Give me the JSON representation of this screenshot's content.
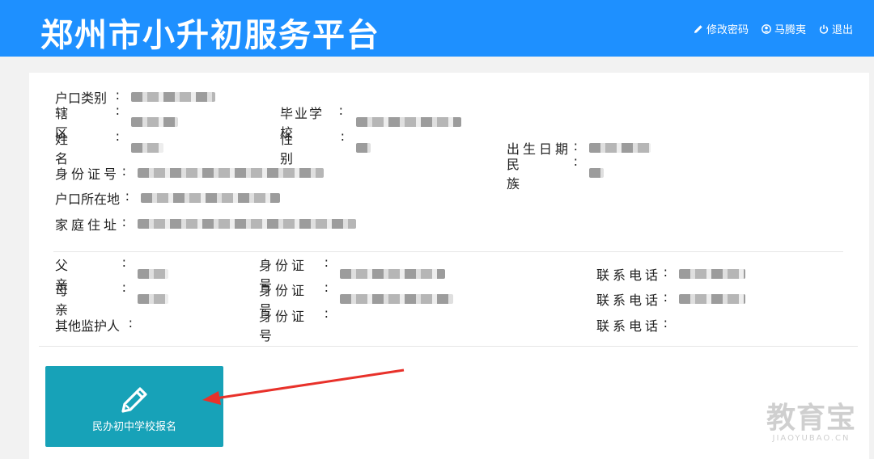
{
  "header": {
    "title": "郑州市小升初服务平台",
    "nav": [
      {
        "label": "修改密码",
        "icon": "pencil-icon"
      },
      {
        "label": "马腾夷",
        "icon": "user-icon"
      },
      {
        "label": "退出",
        "icon": "power-icon"
      }
    ]
  },
  "student": {
    "hukou_type_label": "户口类别",
    "district_label": "辖区",
    "school_label": "毕业学校",
    "name_label": "姓名",
    "gender_label": "性别",
    "birth_label": "出生日期",
    "id_label": "身份证号",
    "ethnicity_label": "民族",
    "hukou_addr_label": "户口所在地",
    "home_addr_label": "家庭住址"
  },
  "guardians": {
    "father_label": "父亲",
    "mother_label": "母亲",
    "other_label": "其他监护人",
    "id_label": "身份证号",
    "phone_label": "联系电话"
  },
  "action": {
    "signup_label": "民办初中学校报名",
    "icon": "pencil-icon"
  },
  "watermark": {
    "main": "教育宝",
    "sub": "JIAOYUBAO.CN"
  },
  "colors": {
    "header": "#1e90ff",
    "button": "#17a2b8",
    "arrow": "#e8312a"
  }
}
